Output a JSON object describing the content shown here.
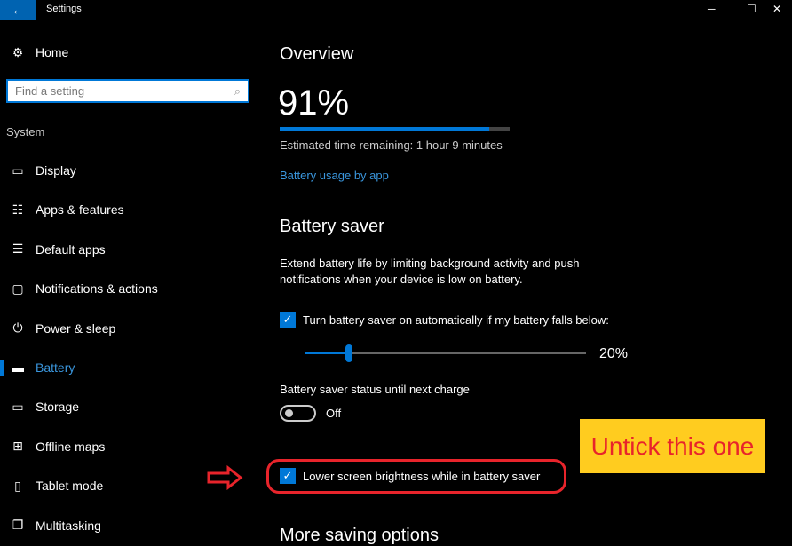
{
  "window": {
    "title": "Settings",
    "back_icon": "arrow-left-icon",
    "minimize": "─",
    "maximize": "☐",
    "close": "✕"
  },
  "sidebar": {
    "home": "Home",
    "search_placeholder": "Find a setting",
    "section": "System",
    "items": [
      {
        "label": "Display",
        "icon": "▭"
      },
      {
        "label": "Apps & features",
        "icon": "☷"
      },
      {
        "label": "Default apps",
        "icon": "☰"
      },
      {
        "label": "Notifications & actions",
        "icon": "▢"
      },
      {
        "label": "Power & sleep",
        "icon": "⏻"
      },
      {
        "label": "Battery",
        "icon": "▬"
      },
      {
        "label": "Storage",
        "icon": "▭"
      },
      {
        "label": "Offline maps",
        "icon": "⊞"
      },
      {
        "label": "Tablet mode",
        "icon": "▯"
      },
      {
        "label": "Multitasking",
        "icon": "❐"
      }
    ],
    "selected": "Battery"
  },
  "overview": {
    "heading": "Overview",
    "percent": "91%",
    "charge_level": 91,
    "estimate": "Estimated time remaining: 1 hour 9 minutes",
    "usage_link": "Battery usage by app"
  },
  "battery_saver": {
    "heading": "Battery saver",
    "description_1": "Extend battery life by limiting background activity and push",
    "description_2": "notifications when your device is low on battery.",
    "auto_label": "Turn battery saver on automatically if my battery falls below:",
    "auto_checked": true,
    "threshold": "20%",
    "threshold_value": 20,
    "status_label": "Battery saver status until next charge",
    "status_value": "Off",
    "brightness_label": "Lower screen brightness while in battery saver",
    "brightness_checked": true
  },
  "more": {
    "heading": "More saving options"
  },
  "annotation": {
    "text": "Untick this one",
    "box_color": "#ffcc1f",
    "text_color": "#e8242b"
  },
  "colors": {
    "accent": "#0078d7",
    "link": "#3a96dd"
  }
}
